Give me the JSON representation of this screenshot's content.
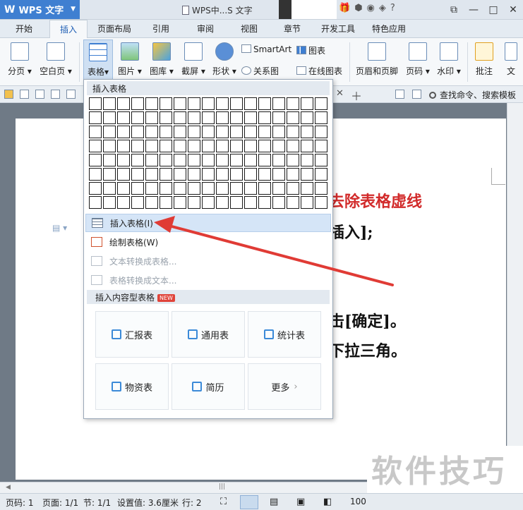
{
  "titlebar": {
    "app_label": "WPS 文字",
    "doc_title": "WPS中...S 文字",
    "icons": [
      "lock-icon",
      "gift-icon",
      "skin-icon",
      "help-icon"
    ],
    "help_label": "?"
  },
  "menubar": {
    "tabs": [
      "开始",
      "插入",
      "页面布局",
      "引用",
      "审阅",
      "视图",
      "章节",
      "开发工具",
      "特色应用"
    ],
    "active": "插入"
  },
  "ribbon": {
    "page_break": "分页",
    "blank_page": "空白页",
    "table": "表格",
    "picture": "图片",
    "gallery": "图库",
    "screenshot": "截屏",
    "shapes": "形状",
    "smartart": "SmartArt",
    "chart": "图表",
    "relation": "关系图",
    "online_chart": "在线图表",
    "header_footer": "页眉和页脚",
    "page_number": "页码",
    "watermark": "水印",
    "comment": "批注",
    "text": "文"
  },
  "search": {
    "label": "查找命令、搜索模板"
  },
  "dropdown": {
    "header": "插入表格",
    "grid": {
      "rows": 8,
      "cols": 17
    },
    "items": [
      {
        "label": "插入表格(I)",
        "state": "highlighted"
      },
      {
        "label": "绘制表格(W)",
        "state": "normal"
      },
      {
        "label": "文本转换成表格...",
        "state": "disabled"
      },
      {
        "label": "表格转换成文本...",
        "state": "disabled"
      }
    ],
    "section2": {
      "header": "插入内容型表格",
      "badge": "NEW"
    },
    "templates": [
      {
        "label": "汇报表"
      },
      {
        "label": "通用表"
      },
      {
        "label": "统计表"
      },
      {
        "label": "物资表"
      },
      {
        "label": "简历"
      },
      {
        "label": "更多"
      }
    ]
  },
  "document": {
    "line1": "去除表格虚线",
    "line2": "插入];",
    "line3": "击[确定]。",
    "line4": "下拉三角。"
  },
  "statusbar": {
    "page": "页码: 1",
    "pages": "页面: 1/1",
    "section": "节: 1/1",
    "setting": "设置值: 3.6厘米",
    "row": "行: 2",
    "zoom": "100"
  },
  "watermark_text": "软件技巧",
  "colors": {
    "accent": "#3f7fd1",
    "arrow": "#e03b35",
    "red_text": "#d22b2b"
  }
}
